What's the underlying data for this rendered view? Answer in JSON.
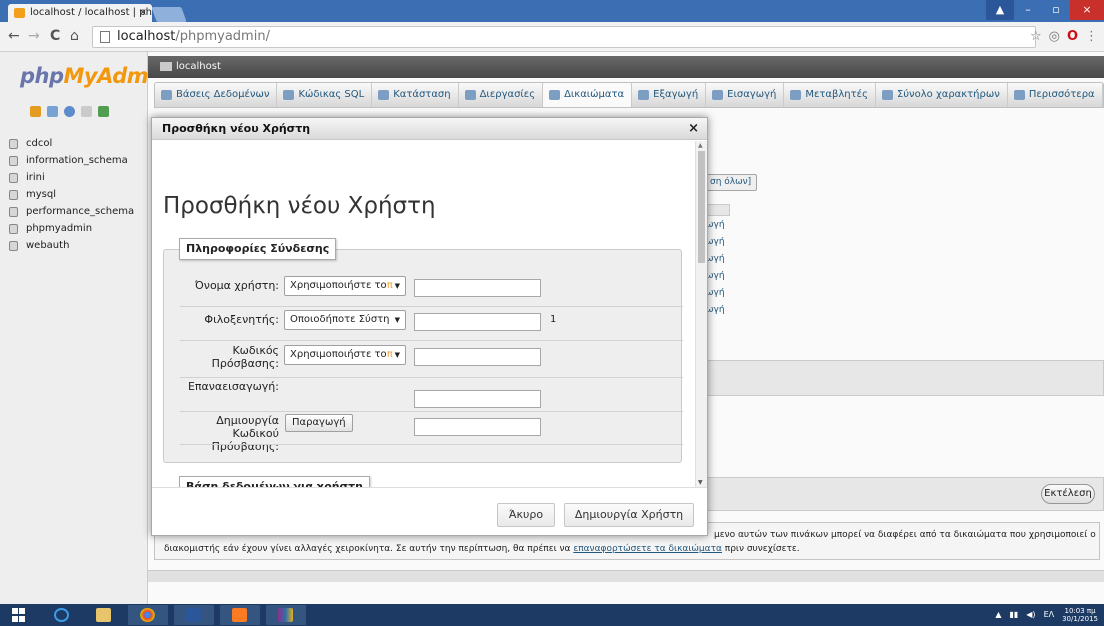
{
  "browser": {
    "tab_title": "localhost / localhost | php",
    "tab_close": "×",
    "url_host": "localhost",
    "url_path": "/phpmyadmin/",
    "nav_back": "←",
    "nav_forward": "→",
    "nav_reload": "C",
    "nav_home": "⌂",
    "star": "☆",
    "ext_icon": "◎",
    "opera_icon": "O",
    "menu_icon": "⋮",
    "win_user": "▲",
    "win_minimize": "–",
    "win_maximize": "▫",
    "win_close": "×"
  },
  "sidebar": {
    "logo_php": "php",
    "logo_my": "MyAdmin",
    "quick_icons": [
      "home-icon",
      "exit-icon",
      "help-icon",
      "docs-icon",
      "reload-icon"
    ],
    "quick_colors": [
      "#e8a020",
      "#7aa6d8",
      "#5e8fd0",
      "#cfcfcf",
      "#53a153"
    ],
    "databases": [
      "cdcol",
      "information_schema",
      "irini",
      "mysql",
      "performance_schema",
      "phpmyadmin",
      "webauth"
    ]
  },
  "main": {
    "server_label": "localhost",
    "tabs": [
      {
        "label": "Βάσεις Δεδομένων",
        "active": false
      },
      {
        "label": "Κώδικας SQL",
        "active": false
      },
      {
        "label": "Κατάσταση",
        "active": false
      },
      {
        "label": "Διεργασίες",
        "active": false
      },
      {
        "label": "Δικαιώματα",
        "active": true
      },
      {
        "label": "Εξαγωγή",
        "active": false
      },
      {
        "label": "Εισαγωγή",
        "active": false
      },
      {
        "label": "Μεταβλητές",
        "active": false
      },
      {
        "label": "Σύνολο χαρακτήρων",
        "active": false
      },
      {
        "label": "Περισσότερα",
        "active": false
      }
    ],
    "bg_partial_button": "ση όλων]",
    "bg_partial_rows": [
      "ωγή",
      "ωγή",
      "ωγή",
      "ωγή",
      "ωγή",
      "ωγή"
    ],
    "execute_button": "Εκτέλεση",
    "notice_text_1": "μενο αυτών των πινάκων μπορεί να διαφέρει από τα δικαιώματα που χρησιμοποιεί ο",
    "notice_text_2_pre": "διακομιστής εάν έχουν γίνει αλλαγές χειροκίνητα. Σε αυτήν την περίπτωση, θα πρέπει να ",
    "notice_link": "επαναφορτώσετε τα δικαιώματα",
    "notice_text_2_post": " πριν συνεχίσετε."
  },
  "dialog": {
    "title": "Προσθήκη νέου Χρήστη",
    "close": "×",
    "heading": "Προσθήκη νέου Χρήστη",
    "login_legend": "Πληροφορίες Σύνδεσης",
    "fields": [
      {
        "label": "Όνομα χρήστη:",
        "select": "Χρησιμοποιήστε το",
        "select_tail": "π"
      },
      {
        "label": "Φιλοξενητής:",
        "select": "Οποιοδήποτε Σύστη",
        "select_tail": "",
        "index": "1"
      },
      {
        "label_1": "Κωδικός",
        "label_2": "Πρόσβασης:",
        "select": "Χρησιμοποιήστε το",
        "select_tail": "π"
      },
      {
        "label": "Επαναεισαγωγή:"
      },
      {
        "label_1": "Δημιουργία",
        "label_2": "Κωδικού",
        "label_3": "Πρόσβασης:",
        "button": "Παραγωγή"
      }
    ],
    "db_legend": "Βάση δεδομένων για χρήστη",
    "cancel_button": "Άκυρο",
    "create_button": "Δημιουργία Χρήστη"
  },
  "taskbar": {
    "tray_lang": "ΕΛ",
    "tray_time": "10:03 πμ",
    "tray_date": "30/1/2015"
  }
}
